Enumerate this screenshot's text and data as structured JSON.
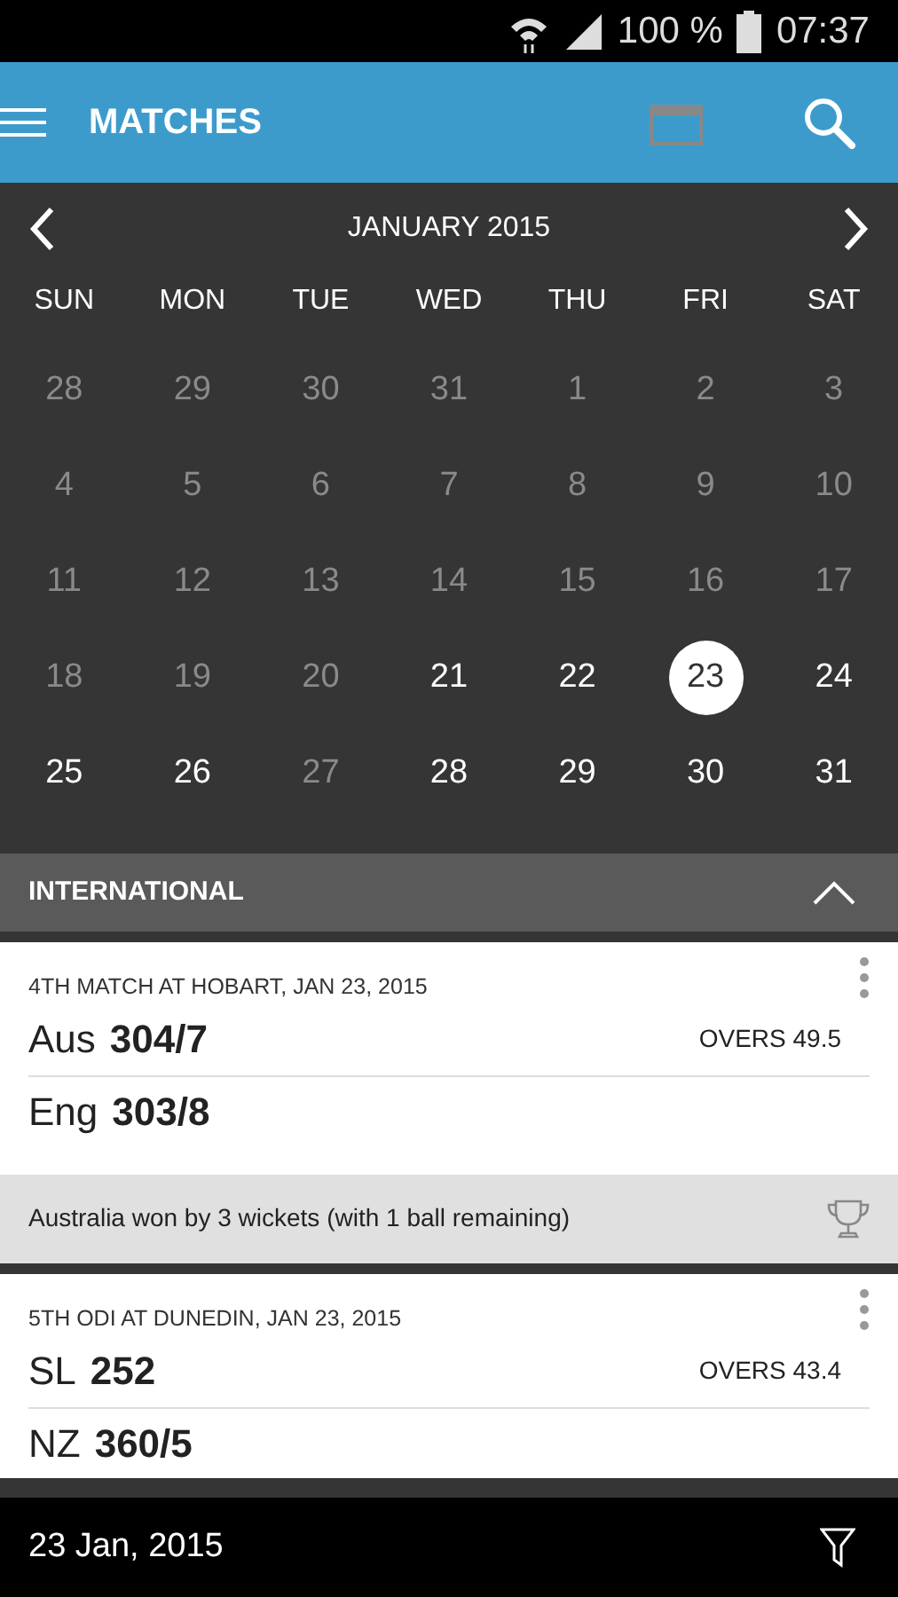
{
  "status_bar": {
    "battery": "100 %",
    "time": "07:37"
  },
  "app_bar": {
    "title": "MATCHES"
  },
  "calendar": {
    "month": "JANUARY 2015",
    "weekdays": [
      "SUN",
      "MON",
      "TUE",
      "WED",
      "THU",
      "FRI",
      "SAT"
    ],
    "weeks": [
      [
        {
          "day": "28",
          "muted": true,
          "selected": false
        },
        {
          "day": "29",
          "muted": true,
          "selected": false
        },
        {
          "day": "30",
          "muted": true,
          "selected": false
        },
        {
          "day": "31",
          "muted": true,
          "selected": false
        },
        {
          "day": "1",
          "muted": true,
          "selected": false
        },
        {
          "day": "2",
          "muted": true,
          "selected": false
        },
        {
          "day": "3",
          "muted": true,
          "selected": false
        }
      ],
      [
        {
          "day": "4",
          "muted": true,
          "selected": false
        },
        {
          "day": "5",
          "muted": true,
          "selected": false
        },
        {
          "day": "6",
          "muted": true,
          "selected": false
        },
        {
          "day": "7",
          "muted": true,
          "selected": false
        },
        {
          "day": "8",
          "muted": true,
          "selected": false
        },
        {
          "day": "9",
          "muted": true,
          "selected": false
        },
        {
          "day": "10",
          "muted": true,
          "selected": false
        }
      ],
      [
        {
          "day": "11",
          "muted": true,
          "selected": false
        },
        {
          "day": "12",
          "muted": true,
          "selected": false
        },
        {
          "day": "13",
          "muted": true,
          "selected": false
        },
        {
          "day": "14",
          "muted": true,
          "selected": false
        },
        {
          "day": "15",
          "muted": true,
          "selected": false
        },
        {
          "day": "16",
          "muted": true,
          "selected": false
        },
        {
          "day": "17",
          "muted": true,
          "selected": false
        }
      ],
      [
        {
          "day": "18",
          "muted": true,
          "selected": false
        },
        {
          "day": "19",
          "muted": true,
          "selected": false
        },
        {
          "day": "20",
          "muted": true,
          "selected": false
        },
        {
          "day": "21",
          "muted": false,
          "selected": false
        },
        {
          "day": "22",
          "muted": false,
          "selected": false
        },
        {
          "day": "23",
          "muted": false,
          "selected": true
        },
        {
          "day": "24",
          "muted": false,
          "selected": false
        }
      ],
      [
        {
          "day": "25",
          "muted": false,
          "selected": false
        },
        {
          "day": "26",
          "muted": false,
          "selected": false
        },
        {
          "day": "27",
          "muted": true,
          "selected": false
        },
        {
          "day": "28",
          "muted": false,
          "selected": false
        },
        {
          "day": "29",
          "muted": false,
          "selected": false
        },
        {
          "day": "30",
          "muted": false,
          "selected": false
        },
        {
          "day": "31",
          "muted": false,
          "selected": false
        }
      ]
    ]
  },
  "section": {
    "title": "INTERNATIONAL",
    "expanded": true
  },
  "matches": [
    {
      "title": "4TH MATCH AT HOBART, JAN 23, 2015",
      "innings": [
        {
          "team": "Aus",
          "score": "304/7",
          "overs": "OVERS 49.5"
        },
        {
          "team": "Eng",
          "score": "303/8"
        }
      ],
      "result": "Australia won by 3 wickets (with 1 ball remaining)"
    },
    {
      "title": "5TH ODI AT DUNEDIN, JAN 23, 2015",
      "innings": [
        {
          "team": "SL",
          "score": "252",
          "overs": "OVERS 43.4"
        },
        {
          "team": "NZ",
          "score": "360/5"
        }
      ]
    }
  ],
  "bottom_bar": {
    "date": "23 Jan, 2015"
  }
}
